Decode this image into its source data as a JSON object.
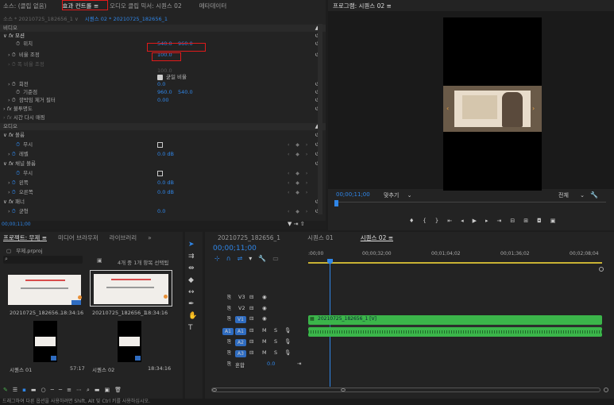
{
  "effect_panel": {
    "tabs": [
      "소스: (클립 없음)",
      "효과 컨트롤 ≡",
      "오디오 클립 믹서: 시퀀스 02",
      "메타데이터"
    ],
    "breadcrumb_source": "소스 * 20210725_182656_1 ∨",
    "breadcrumb_clip": "시퀀스 02 * 20210725_182656_1",
    "video_header": "비디오",
    "motion_label": "모션",
    "position_label": "위치",
    "position_x": "540.0",
    "position_y": "960.0",
    "scale_label": "비율 조정",
    "scale_value": "100.0",
    "scale_width_label": "폭 비율 조정",
    "scale_width_value": "100.0",
    "uniform_scale_label": "균일 비율",
    "rotation_label": "회전",
    "rotation_value": "0.0",
    "anchor_label": "기준점",
    "anchor_x": "960.0",
    "anchor_y": "540.0",
    "flicker_label": "깜박임 제거 필터",
    "flicker_value": "0.00",
    "opacity_label": "불투명도",
    "time_remap_label": "시간 다시 매핑",
    "audio_header": "오디오",
    "volume_label": "볼륨",
    "bypass_label": "무시",
    "level_label": "레벨",
    "level_value": "0.0 dB",
    "channel_volume_label": "채널 볼륨",
    "bypass2_label": "무시",
    "left_label": "왼쪽",
    "left_value": "0.0 dB",
    "right_label": "오른쪽",
    "right_value": "0.0 dB",
    "panner_label": "패너",
    "balance_label": "균형",
    "balance_value": "0.0",
    "timecode": "00;00;11;00"
  },
  "program_monitor": {
    "title": "프로그램: 시퀀스 02 ≡",
    "timecode": "00;00;11;00",
    "fit_label": "맞추기",
    "quality_label": "전체"
  },
  "project_panel": {
    "tabs": [
      "프로젝트: 무제 ≡",
      "미디어 브라우저",
      "라이브러리"
    ],
    "project_file": "무제.prproj",
    "selection_info": "4개 중 1개 항목 선택됨",
    "items": [
      {
        "name": "20210725_182656...",
        "duration": "18:34:16"
      },
      {
        "name": "20210725_182656_1",
        "duration": "18:34:16"
      },
      {
        "name": "시퀀스 01",
        "duration": "57:17"
      },
      {
        "name": "시퀀스 02",
        "duration": "18:34:16"
      }
    ]
  },
  "timeline": {
    "tabs": [
      "20210725_182656_1",
      "시퀀스 01",
      "시퀀스 02 ≡"
    ],
    "timecode": "00;00;11;00",
    "ruler": [
      ":00;00",
      "00;00;32;00",
      "00;01;04;02",
      "00;01;36;02",
      "00;02;08;04"
    ],
    "video_tracks": [
      "V3",
      "V2",
      "V1"
    ],
    "audio_tracks": [
      "A1",
      "A2",
      "A3"
    ],
    "master_label": "혼합",
    "master_value": "0.0",
    "clip_label": "20210725_182656_1 [V]"
  },
  "status_bar": "드래그하여 다른 옵션을 사용하려면 Shift, Alt 및 Ctrl 키를 사용하십시오.",
  "colors": {
    "accent": "#2f86e8",
    "clip_green": "#3bb54a",
    "highlight": "#e01a1a"
  }
}
